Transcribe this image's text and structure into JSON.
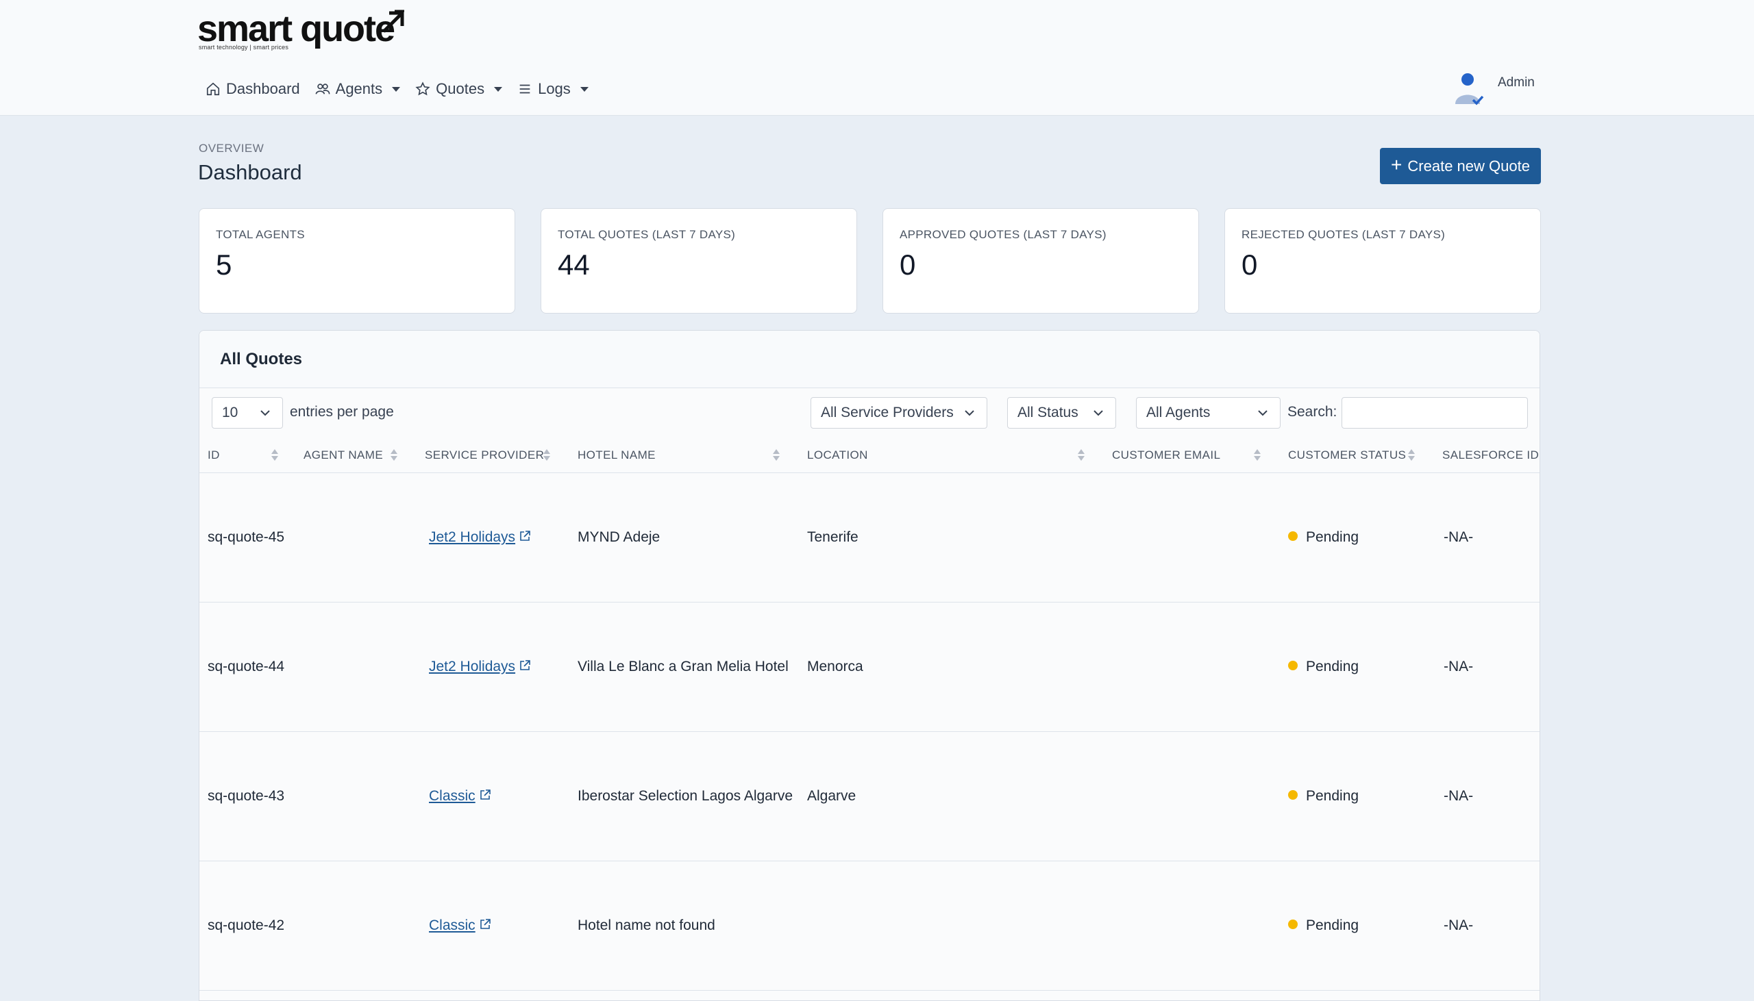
{
  "brand": {
    "name": "smart quote",
    "tagline": "smart technology | smart prices"
  },
  "nav": {
    "items": [
      {
        "label": "Dashboard",
        "icon": "home-icon"
      },
      {
        "label": "Agents",
        "icon": "users-icon"
      },
      {
        "label": "Quotes",
        "icon": "star-icon"
      },
      {
        "label": "Logs",
        "icon": "list-icon"
      }
    ]
  },
  "user": {
    "name": "Admin"
  },
  "header": {
    "overview": "OVERVIEW",
    "title": "Dashboard",
    "create_button": "Create new Quote"
  },
  "stats": [
    {
      "label": "TOTAL AGENTS",
      "value": "5"
    },
    {
      "label": "TOTAL QUOTES (LAST 7 DAYS)",
      "value": "44"
    },
    {
      "label": "APPROVED QUOTES (LAST 7 DAYS)",
      "value": "0"
    },
    {
      "label": "REJECTED QUOTES (LAST 7 DAYS)",
      "value": "0"
    }
  ],
  "quotes": {
    "title": "All Quotes",
    "entries_per_page": "10",
    "entries_label": "entries per page",
    "filters": {
      "providers": "All Service Providers",
      "status": "All Status",
      "agents": "All Agents"
    },
    "search_label": "Search:",
    "search_value": "",
    "columns": [
      "ID",
      "AGENT NAME",
      "SERVICE PROVIDER",
      "HOTEL NAME",
      "LOCATION",
      "CUSTOMER EMAIL",
      "CUSTOMER STATUS",
      "SALESFORCE ID"
    ],
    "rows": [
      {
        "id": "sq-quote-45",
        "agent": "",
        "provider": "Jet2 Holidays",
        "hotel": "MYND Adeje",
        "location": "Tenerife",
        "email": "",
        "status": "Pending",
        "salesforce": "-NA-"
      },
      {
        "id": "sq-quote-44",
        "agent": "",
        "provider": "Jet2 Holidays",
        "hotel": "Villa Le Blanc a Gran Melia Hotel",
        "location": "Menorca",
        "email": "",
        "status": "Pending",
        "salesforce": "-NA-"
      },
      {
        "id": "sq-quote-43",
        "agent": "",
        "provider": "Classic",
        "hotel": "Iberostar Selection Lagos Algarve",
        "location": "Algarve",
        "email": "",
        "status": "Pending",
        "salesforce": "-NA-"
      },
      {
        "id": "sq-quote-42",
        "agent": "",
        "provider": "Classic",
        "hotel": "Hotel name not found",
        "location": "",
        "email": "",
        "status": "Pending",
        "salesforce": "-NA-"
      }
    ]
  },
  "colors": {
    "primary": "#1e5a96",
    "pending": "#f5b800",
    "background": "#e8eef5"
  }
}
